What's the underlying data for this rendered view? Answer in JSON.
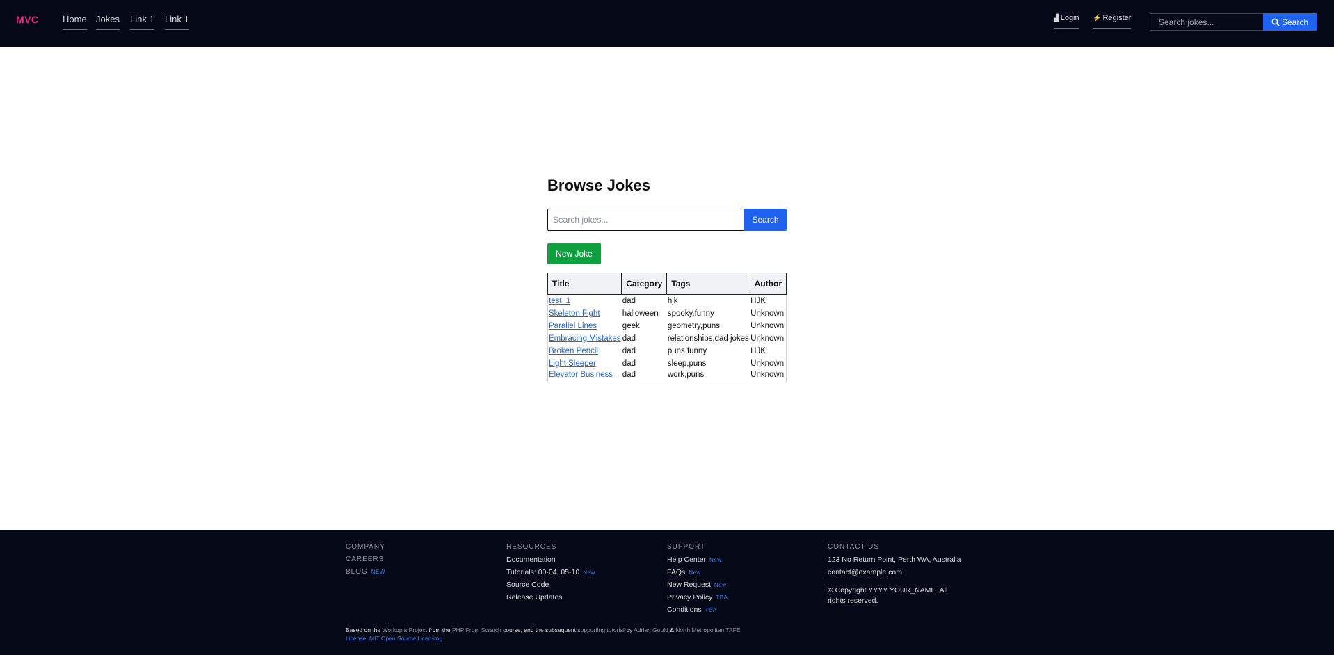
{
  "header": {
    "brand": "MVC",
    "nav": [
      "Home",
      "Jokes",
      "Link 1",
      "Link 1"
    ],
    "login": "Login",
    "register": "Register",
    "search_placeholder": "Search jokes...",
    "search_button": "Search",
    "colors": {
      "background": "#050816",
      "brand": "#ec2f84",
      "accent": "#1e62ee"
    }
  },
  "main": {
    "title": "Browse Jokes",
    "search_placeholder": "Search jokes...",
    "search_button": "Search",
    "new_button": "New Joke",
    "table": {
      "headers": [
        "Title",
        "Category",
        "Tags",
        "Author"
      ],
      "rows": [
        [
          "test_1",
          "dad",
          "hjk",
          "HJK"
        ],
        [
          "Skeleton Fight",
          "halloween",
          "spooky,funny",
          "Unknown"
        ],
        [
          "Parallel Lines",
          "geek",
          "geometry,puns",
          "Unknown"
        ],
        [
          "Embracing Mistakes",
          "dad",
          "relationships,dad jokes",
          "Unknown"
        ],
        [
          "Broken Pencil",
          "dad",
          "puns,funny",
          "HJK"
        ],
        [
          "Light Sleeper",
          "dad",
          "sleep,puns",
          "Unknown"
        ],
        [
          "Elevator Business",
          "dad",
          "work,puns",
          "Unknown"
        ]
      ]
    }
  },
  "footer": {
    "company": {
      "heading": "COMPANY",
      "items": [
        "CAREERS",
        "BLOG"
      ],
      "blog_badge": "NEW"
    },
    "resources": {
      "heading": "RESOURCES",
      "items": [
        "Documentation",
        "Tutorials: 00-04, 05-10",
        "Source Code",
        "Release Updates"
      ],
      "tutorials_badge": "New"
    },
    "support": {
      "heading": "SUPPORT",
      "items": [
        "Help Center",
        "FAQs",
        "New Request",
        "Privacy Policy",
        "Conditions"
      ],
      "badges": [
        "New",
        "New",
        "New",
        "TBA",
        "TBA"
      ]
    },
    "contact": {
      "heading": "CONTACT US",
      "address": "123 No Return Point, Perth WA, Australia",
      "email": "contact@example.com",
      "copyright": "© Copyright YYYY YOUR_NAME. All rights reserved."
    },
    "credit": {
      "t1": "Based on the",
      "link1": "Workopia Project",
      "t2": "from the",
      "link2": "PHP From Scratch",
      "t3": "course, and the subsequent",
      "link3": "supporting tutorial",
      "t4": "by",
      "name1": "Adrian Gould",
      "amp": "&",
      "name2": "North Metropolitan TAFE",
      "license": "License: MIT Open Source Licensing"
    }
  }
}
